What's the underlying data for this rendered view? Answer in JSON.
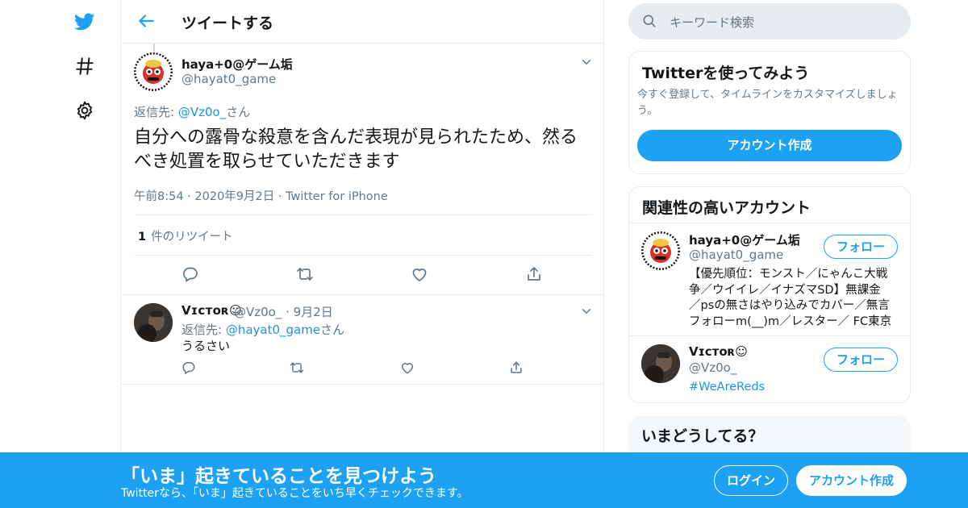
{
  "colors": {
    "accent": "#1da1f2",
    "link": "#1b95e0",
    "text_primary": "#14171a",
    "text_secondary": "#657786",
    "border": "#e6ecf0"
  },
  "nav": {
    "icons": [
      "twitter-bird-icon",
      "hashtag-icon",
      "gear-icon"
    ]
  },
  "header": {
    "title": "ツイートする",
    "back_icon": "arrow-left-icon"
  },
  "main_tweet": {
    "author_name": "haya+0@ゲーム垢",
    "author_handle": "@hayat0_game",
    "reply_to_prefix": "返信先: ",
    "reply_to_handle": "@Vz0o_",
    "reply_to_suffix": "さん",
    "text": "自分への露骨な殺意を含んだ表現が見られたため、然るべき処置を取らせていただきます",
    "time": "午前8:54",
    "date": "2020年9月2日",
    "source": "Twitter for iPhone",
    "retweet_count": "1",
    "retweet_label": "件のリツイート",
    "actions": [
      "reply-icon",
      "retweet-icon",
      "like-icon",
      "share-icon"
    ]
  },
  "reply_tweet": {
    "author_name": "Vɪᴄᴛᴏʀ☺",
    "author_handle": "@Vz0o_",
    "date": "9月2日",
    "reply_to_prefix": "返信先: ",
    "reply_to_handle": "@hayat0_game",
    "reply_to_suffix": "さん",
    "text": "うるさい",
    "actions": [
      "reply-icon",
      "retweet-icon",
      "like-icon",
      "share-icon"
    ]
  },
  "search": {
    "placeholder": "キーワード検索"
  },
  "signup_card": {
    "title": "Twitterを使ってみよう",
    "description": "今すぐ登録して、タイムラインをカスタマイズしましょう。",
    "button": "アカウント作成"
  },
  "related_card": {
    "title": "関連性の高いアカウント",
    "accounts": [
      {
        "name": "haya+0@ゲーム垢",
        "handle": "@hayat0_game",
        "follow_label": "フォロー",
        "bio_lines": [
          "【優先順位：モンスト／にゃんこ大戦",
          "争／ウイイレ／イナズマSD】無課金",
          "／psの無さはやり込みでカバー／無言",
          "フォローm(__)m／レスター／ FC東京"
        ]
      },
      {
        "name": "Vɪᴄᴛᴏʀ☺",
        "handle": "@Vz0o_",
        "follow_label": "フォロー",
        "bio_hashtag": "#WeAreReds"
      }
    ]
  },
  "trends_card": {
    "title": "いまどうしてる？"
  },
  "bottom_bar": {
    "title": "「いま」起きていることを見つけよう",
    "subtitle": "Twitterなら、「いま」起きていることをいち早くチェックできます。",
    "login": "ログイン",
    "signup": "アカウント作成"
  }
}
